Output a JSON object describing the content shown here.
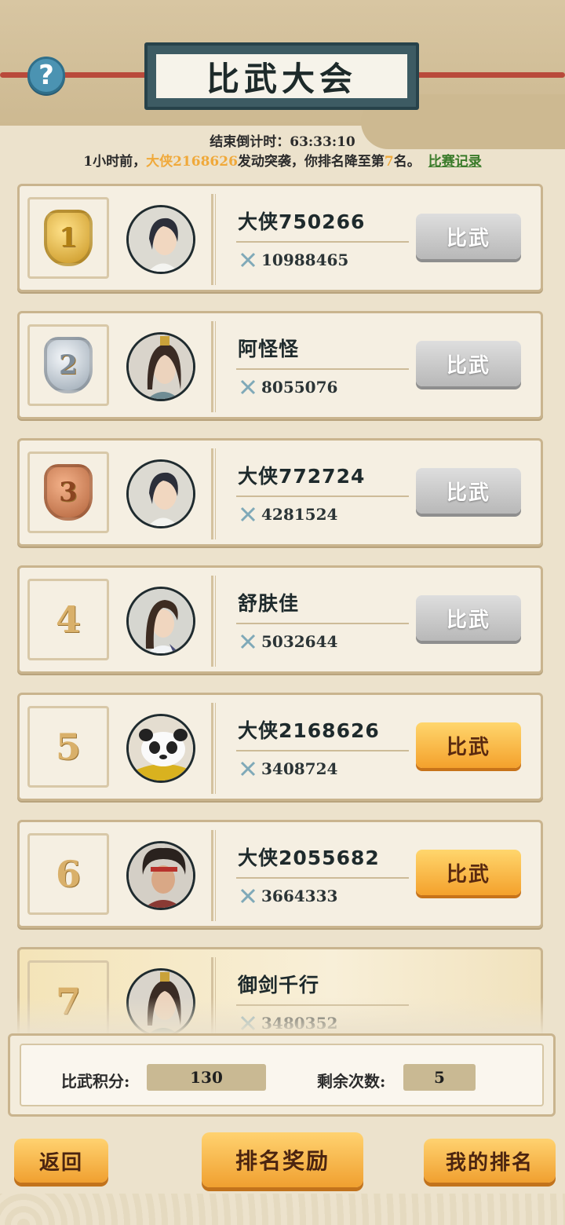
{
  "header": {
    "title": "比武大会",
    "help_icon": "question-mark-icon"
  },
  "countdown": {
    "label": "结束倒计时：",
    "value": "63:33:10"
  },
  "notice": {
    "prefix": "1小时前，",
    "attacker": "大侠2168626",
    "middle": "发动突袭，你排名降至第",
    "rank": "7",
    "suffix": "名。",
    "link": "比赛记录"
  },
  "players": [
    {
      "rank": "1",
      "name": "大侠750266",
      "power": "10988465",
      "button": "比武",
      "button_state": "disabled"
    },
    {
      "rank": "2",
      "name": "阿怪怪",
      "power": "8055076",
      "button": "比武",
      "button_state": "disabled"
    },
    {
      "rank": "3",
      "name": "大侠772724",
      "power": "4281524",
      "button": "比武",
      "button_state": "disabled"
    },
    {
      "rank": "4",
      "name": "舒肤佳",
      "power": "5032644",
      "button": "比武",
      "button_state": "disabled"
    },
    {
      "rank": "5",
      "name": "大侠2168626",
      "power": "3408724",
      "button": "比武",
      "button_state": "active"
    },
    {
      "rank": "6",
      "name": "大侠2055682",
      "power": "3664333",
      "button": "比武",
      "button_state": "active"
    },
    {
      "rank": "7",
      "name": "御剑千行",
      "power": "3480352",
      "button": "",
      "button_state": "self"
    }
  ],
  "stats": {
    "score_label": "比武积分:",
    "score_value": "130",
    "remaining_label": "剩余次数:",
    "remaining_value": "5"
  },
  "footer": {
    "back": "返回",
    "rewards": "排名奖励",
    "my_rank": "我的排名"
  },
  "colors": {
    "highlight": "#f0a93a",
    "link": "#3a7b2a",
    "button_active": "#f4a12c",
    "button_disabled": "#b8b8b8"
  }
}
